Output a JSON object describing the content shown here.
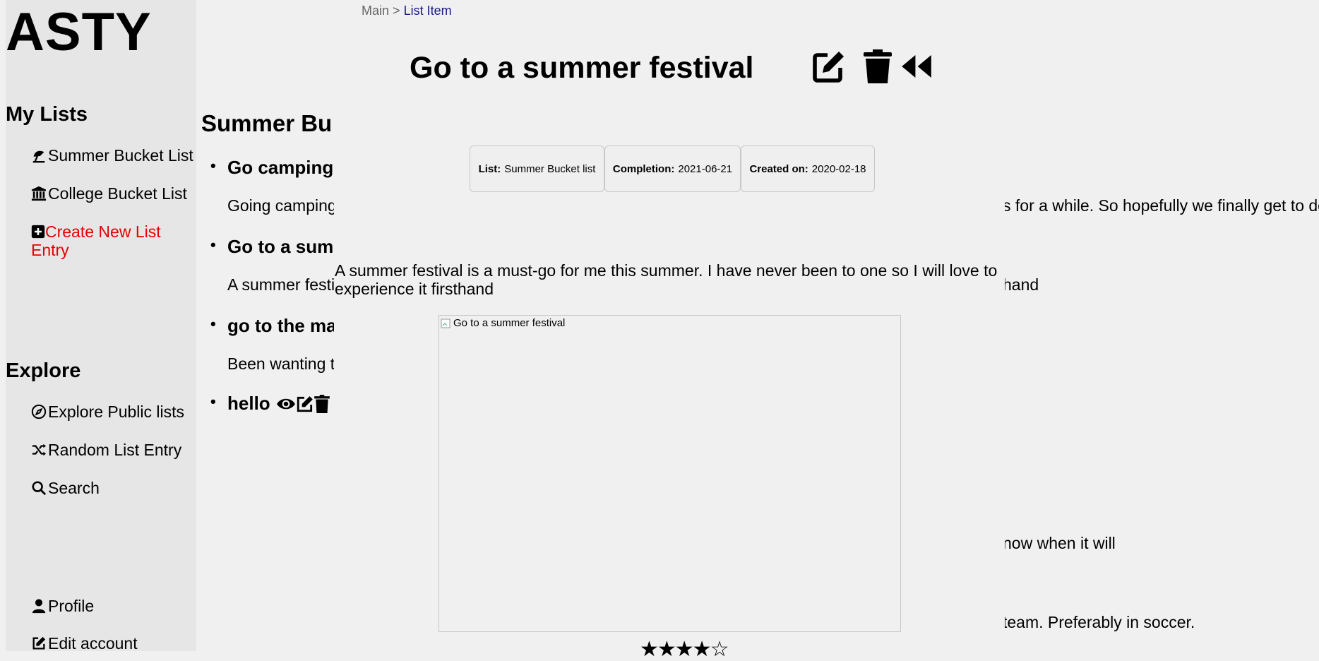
{
  "sidebar": {
    "logo": "ASTY",
    "my_lists_title": "My Lists",
    "lists": [
      {
        "label": "Summer Bucket List",
        "icon": "umbrella-beach-icon"
      },
      {
        "label": "College Bucket List",
        "icon": "university-icon"
      }
    ],
    "create_label": "Create New List Entry",
    "explore_title": "Explore",
    "explore": [
      {
        "label": "Explore Public lists",
        "icon": "compass-icon"
      },
      {
        "label": "Random List Entry",
        "icon": "shuffle-icon"
      },
      {
        "label": "Search",
        "icon": "search-icon"
      }
    ],
    "profile_label": "Profile",
    "edit_account_label": "Edit account"
  },
  "background": {
    "list_title": "Summer Bu",
    "items": [
      {
        "title": "Go camping",
        "desc": "Going camping",
        "desc_right": "s for a while. So hopefully we finally get to do"
      },
      {
        "title": "Go to a sum",
        "desc": "A summer festi",
        "desc_right": "hand"
      },
      {
        "title": "go to the ma",
        "desc": "Been wanting to",
        "desc_right": ""
      },
      {
        "title": "hello",
        "desc": "",
        "desc_right": ""
      }
    ],
    "right_line_1": "now when it will",
    "right_line_2": "team. Preferably in soccer."
  },
  "breadcrumb": {
    "parent": "Main",
    "separator": ">",
    "current": "List Item"
  },
  "item": {
    "title": "Go to a summer festival",
    "meta": {
      "list_label": "List:",
      "list_value": "Summer Bucket list",
      "completion_label": "Completion:",
      "completion_value": "2021-06-21",
      "created_label": "Created on:",
      "created_value": "2020-02-18"
    },
    "description": "A summer festival is a must-go for me this summer. I have never been to one so I will love to experience it firsthand",
    "image_alt": "Go to a summer festival",
    "rating": 4,
    "rating_max": 5,
    "stars_text": "★★★★☆"
  }
}
